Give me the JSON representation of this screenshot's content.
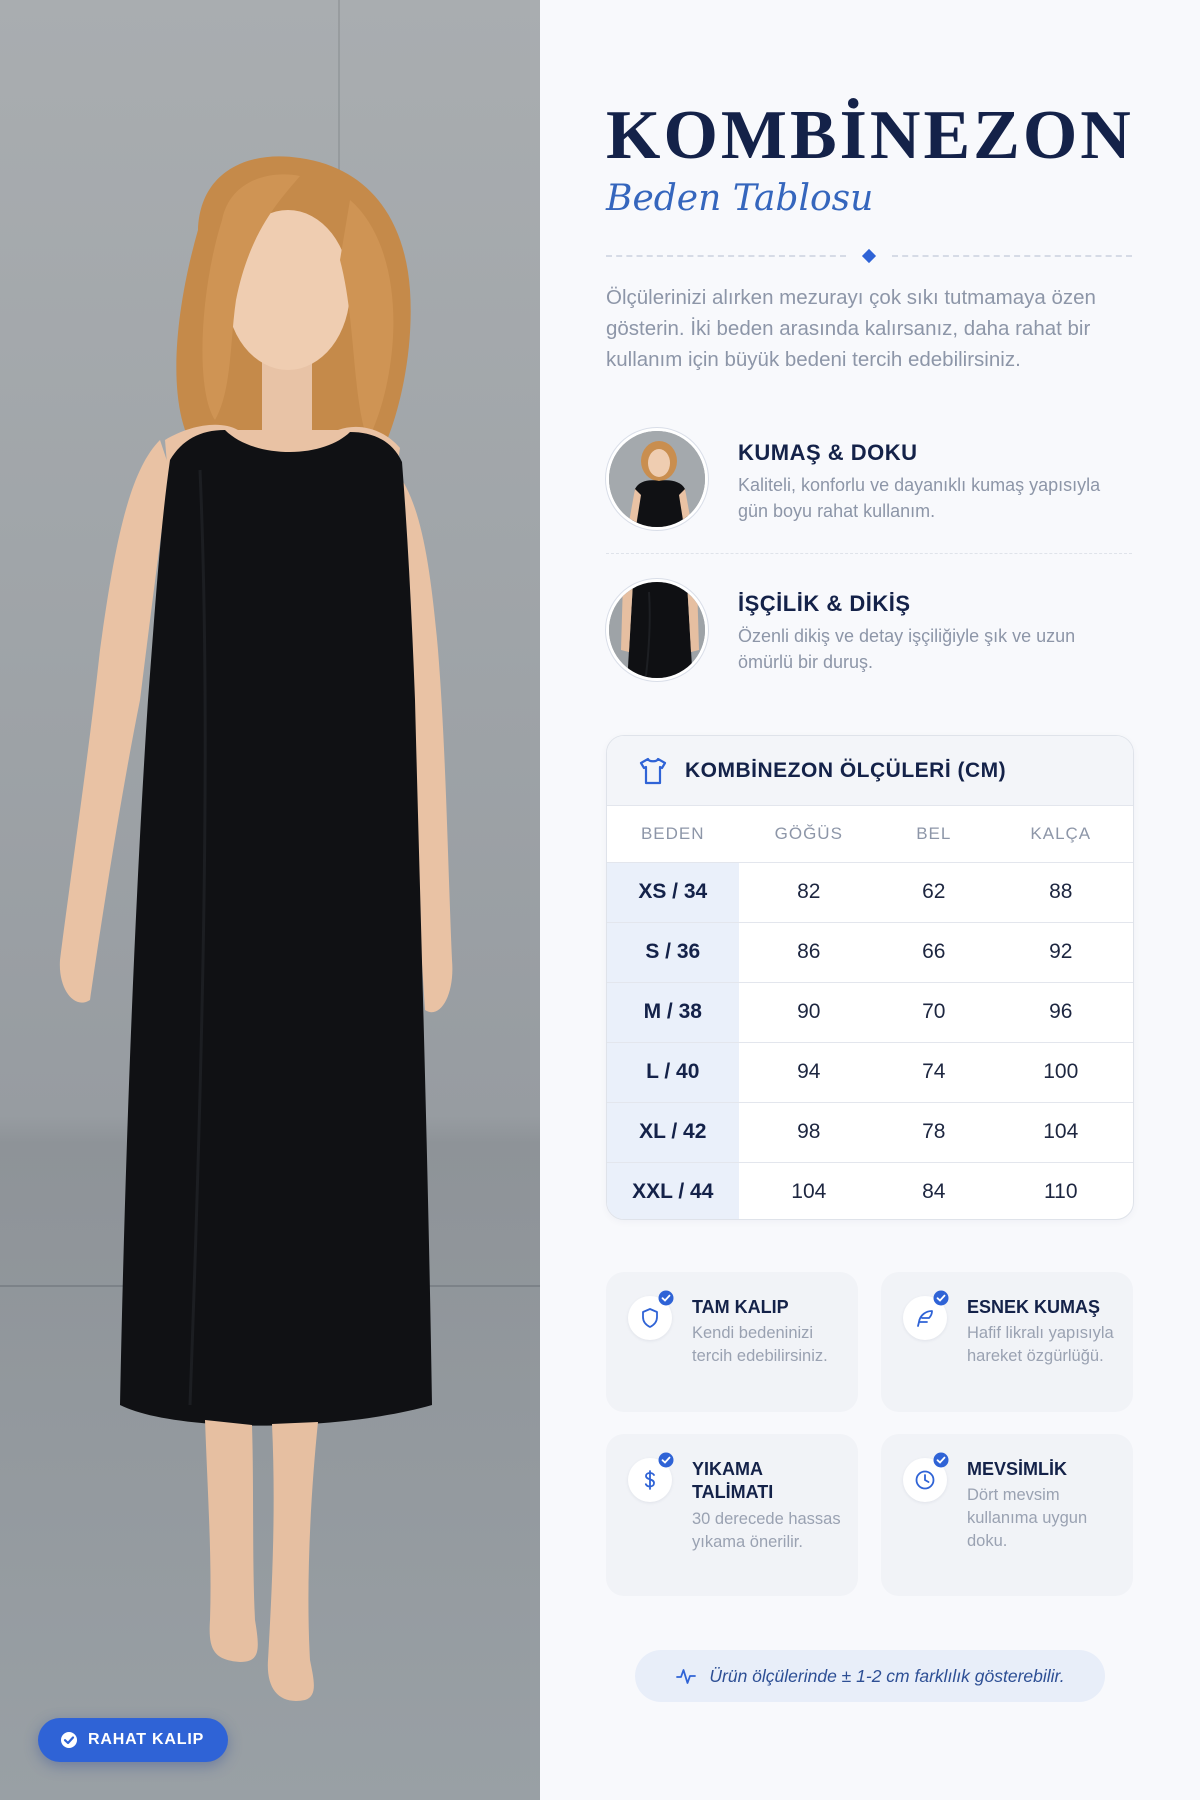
{
  "photo": {
    "badge_label": "RAHAT KALIP",
    "badge_icon": "check-circle-icon"
  },
  "header": {
    "title": "KOMBİNEZON",
    "subtitle": "Beden Tablosu"
  },
  "intro_text": "Ölçülerinizi alırken mezurayı çok sıkı tutmamaya özen gösterin. İki beden arasında kalırsanız, daha rahat bir kullanım için büyük bedeni tercih edebilirsiniz.",
  "features": [
    {
      "title": "KUMAŞ & DOKU",
      "description": "Kaliteli, konforlu ve dayanıklı kumaş yapısıyla gün boyu rahat kullanım."
    },
    {
      "title": "İŞÇİLİK & DİKİŞ",
      "description": "Özenli dikiş ve detay işçiliğiyle şık ve uzun ömürlü bir duruş."
    }
  ],
  "size_table": {
    "title": "KOMBİNEZON ÖLÇÜLERİ (CM)",
    "icon": "shirt-icon",
    "headers": [
      "BEDEN",
      "GÖĞÜS",
      "BEL",
      "KALÇA"
    ],
    "rows": [
      [
        "XS / 34",
        "82",
        "62",
        "88"
      ],
      [
        "S / 36",
        "86",
        "66",
        "92"
      ],
      [
        "M / 38",
        "90",
        "70",
        "96"
      ],
      [
        "L / 40",
        "94",
        "74",
        "100"
      ],
      [
        "XL / 42",
        "98",
        "78",
        "104"
      ],
      [
        "XXL / 44",
        "104",
        "84",
        "110"
      ]
    ]
  },
  "info_cards": [
    {
      "title": "TAM KALIP",
      "description": "Kendi bedeninizi tercih edebilirsiniz.",
      "icon": "shield-icon"
    },
    {
      "title": "ESNEK KUMAŞ",
      "description": "Hafif likralı yapısıyla hareket özgürlüğü.",
      "icon": "feather-icon"
    },
    {
      "title": "YIKAMA TALİMATI",
      "description": "30 derecede hassas yıkama önerilir.",
      "icon": "dollar-icon"
    },
    {
      "title": "MEVSİMLİK",
      "description": "Dört mevsim kullanıma uygun doku.",
      "icon": "clock-icon"
    }
  ],
  "note": {
    "text": "Ürün ölçülerinde ± 1-2 cm farklılık gösterebilir.",
    "icon": "activity-icon"
  },
  "colors": {
    "accent": "#2f63d6",
    "navy": "#142249",
    "muted_text": "#8d96a8",
    "size_cell_bg": "#eaf0fa"
  }
}
